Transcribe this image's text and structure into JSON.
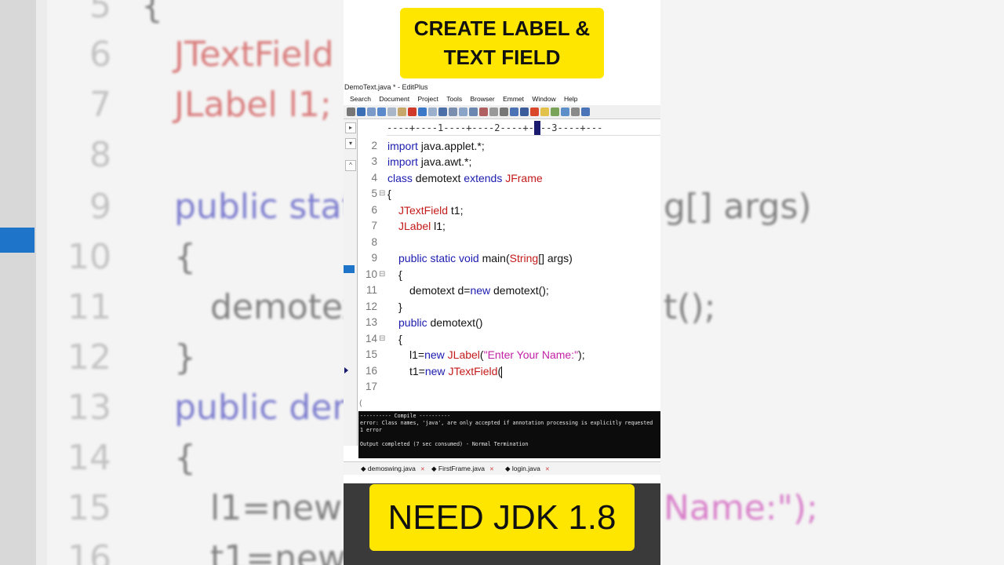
{
  "top_banner": {
    "line1": "CREATE LABEL &",
    "line2": "TEXT FIELD"
  },
  "bottom_banner": {
    "text": "NEED JDK 1.8"
  },
  "editor": {
    "window_title": "DemoText.java * - EditPlus",
    "menu": [
      "Search",
      "Document",
      "Project",
      "Tools",
      "Browser",
      "Emmet",
      "Window",
      "Help"
    ],
    "ruler": "----+----1----+----2----+-",
    "ruler_tail": "--3----+---",
    "code_lines": [
      {
        "num": "2",
        "text": "import java.applet.*;"
      },
      {
        "num": "3",
        "text": "import java.awt.*;"
      },
      {
        "num": "4",
        "text": "class demotext extends JFrame"
      },
      {
        "num": "5",
        "text": "{"
      },
      {
        "num": "6",
        "text": "JTextField t1;"
      },
      {
        "num": "7",
        "text": "JLabel l1;"
      },
      {
        "num": "8",
        "text": ""
      },
      {
        "num": "9",
        "text": "public static void main(String[] args)"
      },
      {
        "num": "10",
        "text": "{"
      },
      {
        "num": "11",
        "text": "demotext d=new demotext();"
      },
      {
        "num": "12",
        "text": "}"
      },
      {
        "num": "13",
        "text": "public demotext()"
      },
      {
        "num": "14",
        "text": "{"
      },
      {
        "num": "15",
        "text": "l1=new JLabel(\"Enter Your Name:\");"
      },
      {
        "num": "16",
        "text": "t1=new JTextField("
      },
      {
        "num": "17",
        "text": ""
      }
    ],
    "output": {
      "line1": "---------- Compile ----------",
      "line2": "error: Class names, 'java', are only accepted if annotation processing is explicitly requested",
      "line3": "1 error",
      "line4": "",
      "line5": "Output completed (7 sec consumed) - Normal Termination"
    },
    "tabs": [
      "demoswing.java",
      "FirstFrame.java",
      "login.java"
    ]
  },
  "background": {
    "lines": [
      {
        "num": "5",
        "code": "{"
      },
      {
        "num": "6",
        "code": "JTextField"
      },
      {
        "num": "7",
        "code": "JLabel l1;"
      },
      {
        "num": "8",
        "code": ""
      },
      {
        "num": "9",
        "code": "public stat"
      },
      {
        "num": "10",
        "code": "{"
      },
      {
        "num": "11",
        "code": "demotex"
      },
      {
        "num": "12",
        "code": "}"
      },
      {
        "num": "13",
        "code": "public den"
      },
      {
        "num": "14",
        "code": "{"
      },
      {
        "num": "15",
        "code": "l1=new"
      },
      {
        "num": "16",
        "code": "t1=new"
      }
    ],
    "right_fragments": [
      "g[] args)",
      "t();",
      "Name:\");"
    ]
  }
}
